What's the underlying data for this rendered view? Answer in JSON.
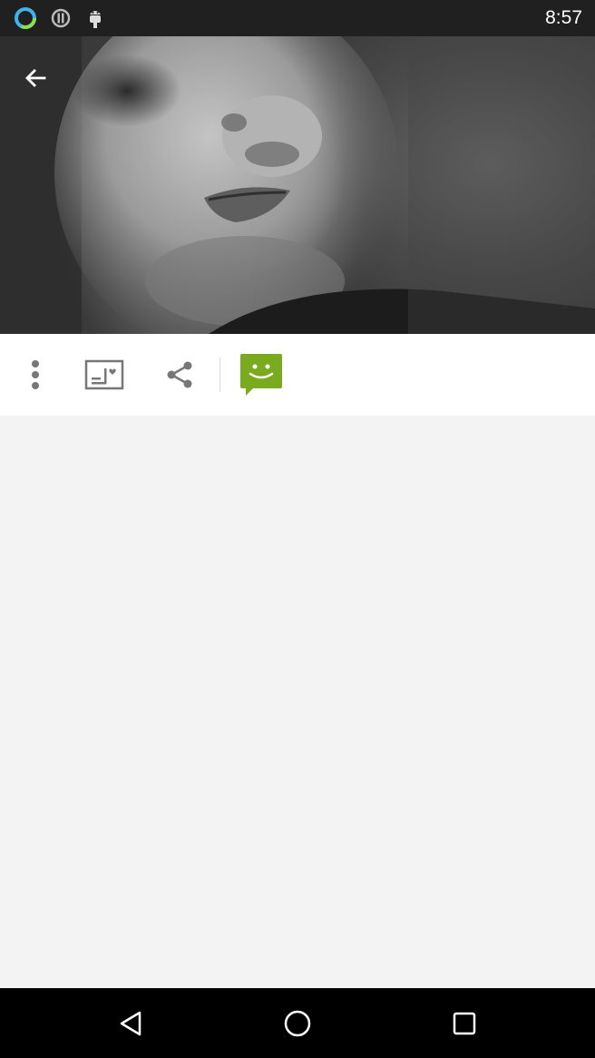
{
  "status_bar": {
    "time": "8:57",
    "icons": [
      "ring-status-icon",
      "data-saver-icon",
      "android-debug-icon"
    ]
  },
  "header": {
    "back_icon": "arrow-back-icon"
  },
  "photo": {
    "description_icon": "profile-photo"
  },
  "toolbar": {
    "items": [
      {
        "name": "more-options-button",
        "icon": "more-vert-icon"
      },
      {
        "name": "postcard-button",
        "icon": "postcard-icon"
      },
      {
        "name": "share-button",
        "icon": "share-icon"
      },
      {
        "name": "chat-button",
        "icon": "chat-smile-icon"
      }
    ],
    "chat_color": "#7aaa1e"
  },
  "nav_bar": {
    "items": [
      "back-triangle-icon",
      "home-circle-icon",
      "recents-square-icon"
    ]
  }
}
